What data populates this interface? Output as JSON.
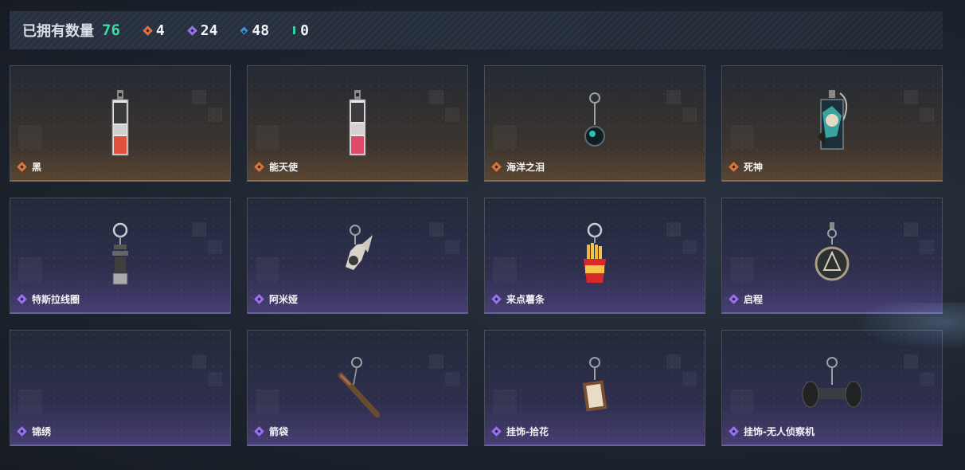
{
  "header": {
    "owned_label": "已拥有数量",
    "owned_count": "76",
    "stats": [
      {
        "icon": "orange-gem-icon",
        "color": "#d9743a",
        "value": "4"
      },
      {
        "icon": "purple-gem-icon",
        "color": "#9a6ff0",
        "value": "24"
      },
      {
        "icon": "blue-gem-icon",
        "color": "#3a93d9",
        "value": "48"
      },
      {
        "icon": "green-gem-icon",
        "color": "#2fd1a0",
        "value": "0"
      }
    ]
  },
  "items": [
    {
      "name": "黑",
      "rarity": "orange",
      "icon": "keycard-charm"
    },
    {
      "name": "能天使",
      "rarity": "orange",
      "icon": "keycard-charm"
    },
    {
      "name": "海洋之泪",
      "rarity": "orange",
      "icon": "pendant-charm"
    },
    {
      "name": "死神",
      "rarity": "orange",
      "icon": "card-charm"
    },
    {
      "name": "特斯拉线圈",
      "rarity": "purple",
      "icon": "coil-charm"
    },
    {
      "name": "阿米娅",
      "rarity": "purple",
      "icon": "rabbit-charm"
    },
    {
      "name": "来点薯条",
      "rarity": "purple",
      "icon": "fries-charm"
    },
    {
      "name": "启程",
      "rarity": "purple",
      "icon": "medal-charm"
    },
    {
      "name": "锦绣",
      "rarity": "purple",
      "icon": "empty"
    },
    {
      "name": "箭袋",
      "rarity": "purple",
      "icon": "quiver-charm"
    },
    {
      "name": "挂饰-拾花",
      "rarity": "purple",
      "icon": "frame-charm"
    },
    {
      "name": "挂饰-无人侦察机",
      "rarity": "purple",
      "icon": "drone-charm"
    }
  ]
}
